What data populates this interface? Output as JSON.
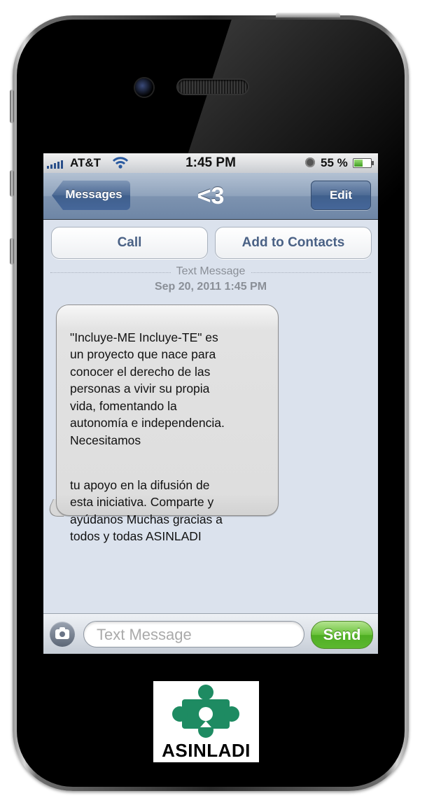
{
  "status_bar": {
    "carrier": "AT&T",
    "time": "1:45 PM",
    "battery_percent": "55 %",
    "battery_level": 0.55,
    "icons": [
      "signal-icon",
      "wifi-icon",
      "alarm-icon",
      "battery-icon"
    ]
  },
  "nav": {
    "back_label": "Messages",
    "title": "<3",
    "edit_label": "Edit"
  },
  "actions": {
    "call_label": "Call",
    "add_contact_label": "Add to Contacts"
  },
  "thread": {
    "type_label": "Text Message",
    "date": "Sep 20, 2011 1:45 PM"
  },
  "message": {
    "paragraph_1": "\"Incluye-ME Incluye-TE\" es\nun proyecto que nace para\nconocer el derecho de las\npersonas a vivir su propia\nvida, fomentando la\nautonomía e independencia.\nNecesitamos",
    "paragraph_2": "tu apoyo en la difusión de\nesta iniciativa. Comparte y\nayúdanos Muchas gracias a\ntodos y todas ASINLADI"
  },
  "compose": {
    "placeholder": "Text Message",
    "send_label": "Send"
  },
  "logo": {
    "text": "ASINLADI",
    "color": "#1e8b62"
  },
  "colors": {
    "nav_blue": "#6e86a6",
    "send_green": "#5cb830",
    "screen_bg": "#dbe2ed"
  }
}
